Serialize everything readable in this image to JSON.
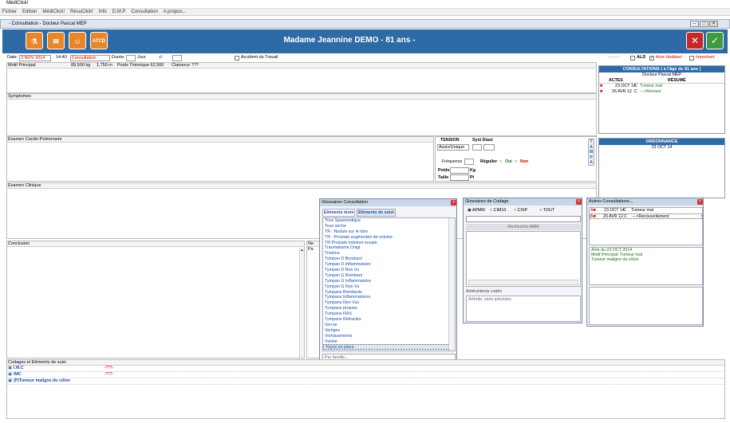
{
  "app": {
    "title": "MédiClick!"
  },
  "menu": [
    "Fichier",
    "Edition",
    "MédiClick!",
    "RésuClick!",
    "Info",
    "D.M.P",
    "Consultation",
    "A propos..."
  ],
  "window": {
    "title": "- Consultation - Docteur Pascal MEP"
  },
  "header": {
    "patient": "Madame Jeannine DEMO - 81 ans  -",
    "buttons": [
      "ATCD"
    ]
  },
  "form": {
    "date_label": "Date:",
    "date_value": "3 NOV 2014",
    "time": "14:40",
    "type": "Consultation",
    "duree_label": "Durée:",
    "jour_label": "Jour",
    "accident": "Accident du Travail",
    "ald": "ALD",
    "acte_habituel": "Acte Habituel",
    "important": "Important",
    "motif_label": "Motif Principal",
    "poids": "89,500 kg",
    "taille": "1,750 m",
    "poids_theo": "Poids Théorique 62,500",
    "clairance": "Clairance ???"
  },
  "sections": {
    "symptomes": "Symptomes",
    "cardio": "Examen Cardio-Pulmonaire",
    "clinique": "Examen Clinique",
    "conclusion": "Conclusion",
    "ne_pas": "Ne Pa",
    "codages": "Codages et Eléments de suivi"
  },
  "tension": {
    "label": "TENSION",
    "syst_diast": "Syst Diast",
    "position": "Assis/Unique",
    "frequence": "Fréquence",
    "regulier": "Régulier",
    "oui": "Oui",
    "non": "Non",
    "poids": "Poids",
    "kg": "Kg",
    "taille": "Taille",
    "pt": "Pt",
    "side": [
      "T",
      "A",
      "M",
      "P",
      "A"
    ]
  },
  "consultations": {
    "header": "CONSULTATIONS ( à l'âge de 81 ans )",
    "doctor": "Docteur Pascal MEP",
    "col_actes": "ACTES",
    "col_resume": "RÉSUMÉ",
    "rows": [
      {
        "date": "23 OCT 14",
        "code": "C",
        "text": "Tumeur mal"
      },
      {
        "date": "26 AVR 12",
        "code": "C",
        "text": "--->Renouv"
      }
    ]
  },
  "ordonnance": {
    "header": "ORDONNANCE",
    "date": "23 OCT 14"
  },
  "glossaire": {
    "title": "Glossaires Consultation",
    "tab1": "Eléments texte",
    "tab2": "Eléments de suivi",
    "items": [
      "Toux Spasmodique",
      "Toux sèche",
      "TR : Nodule sur le lobe",
      "TR : Prostate augmentée de volume",
      "TR Prostate  indolore souple",
      "Traumatisme Doigt",
      "Trismus",
      "Tympan D Bombant",
      "Tympan D Inflammatoire",
      "Tympan D Non Vu",
      "Tympan G Bombant",
      "Tympan G Inflammatoire",
      "Tympan G Non Vu",
      "Tympans Bombants",
      "Tympans Inflammatoires",
      "Tympans Non Vus",
      "Tympans propres",
      "Tympans RAS",
      "Tympans Rétractés",
      "Verrue",
      "Vertiges",
      "Vomissements",
      "Vulvite",
      "Yoyos en place"
    ],
    "filter": "Par famille..."
  },
  "codage": {
    "title": "Glossaires de Codage",
    "opts": [
      "APMM",
      "CIM10",
      "CISP",
      "TOUT"
    ],
    "search": "Recherche AMM",
    "antecedents": "Antécédents codés",
    "ante_item": "Arthrite, sans précision"
  },
  "autres": {
    "title": "Autres Consultations...",
    "rows": [
      {
        "date": "23 OCT 14",
        "code": "C",
        "text": "Tumeur mal"
      },
      {
        "date": "26 AVR 12",
        "code": "C",
        "text": "--->Renouvellement"
      }
    ],
    "detail": [
      "Acte du 23 OCT 2014",
      "Motif Principal: Tumeur mal",
      "Tumeur maligne du côlon"
    ]
  },
  "codages_rows": [
    {
      "label": "I.M.C",
      "value": "-???-"
    },
    {
      "label": "IMC",
      "value": "-???-"
    },
    {
      "label": "(P)Tumeur maligne du côlon",
      "value": ""
    }
  ]
}
